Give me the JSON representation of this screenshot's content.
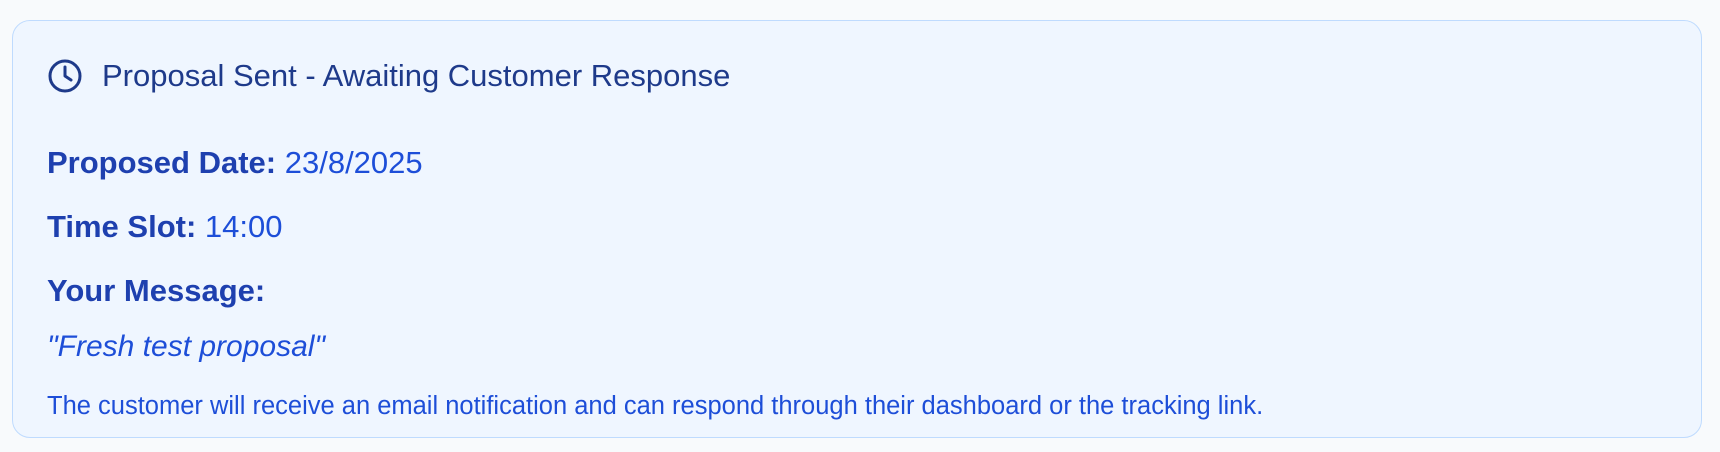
{
  "status": {
    "icon": "clock-icon",
    "title": "Proposal Sent - Awaiting Customer Response"
  },
  "details": {
    "proposed_date_label": "Proposed Date:",
    "proposed_date_value": "23/8/2025",
    "time_slot_label": "Time Slot:",
    "time_slot_value": "14:00",
    "message_label": "Your Message:",
    "message_value": "\"Fresh test proposal\""
  },
  "note": "The customer will receive an email notification and can respond through their dashboard or the tracking link.",
  "colors": {
    "card_background": "#eff6ff",
    "card_border": "#bfdbfe",
    "title": "#1e3a8a",
    "label": "#1e40af",
    "text": "#1d4ed8"
  }
}
